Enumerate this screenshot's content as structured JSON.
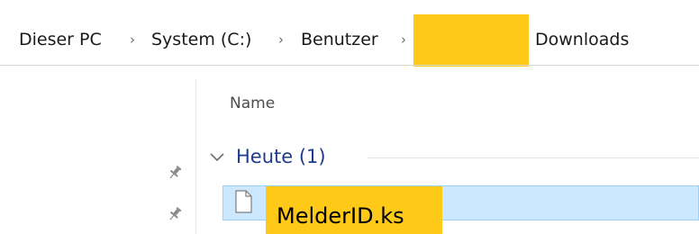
{
  "breadcrumb": {
    "items": [
      {
        "label": "Dieser PC"
      },
      {
        "label": "System (C:)"
      },
      {
        "label": "Benutzer"
      },
      {
        "label": ""
      },
      {
        "label": "Downloads"
      }
    ],
    "separator_icon": "chevron-right-icon"
  },
  "file_list": {
    "column_header": "Name",
    "groups": [
      {
        "label": "Heute (1)",
        "expanded": true,
        "files": [
          {
            "name": "MelderID.ks",
            "icon": "generic-file-icon",
            "selected": true
          }
        ]
      }
    ]
  },
  "nav_pane": {
    "pin_icons": [
      "pin-icon",
      "pin-icon"
    ]
  },
  "colors": {
    "selection_bg": "#cce8ff",
    "selection_border": "#99d1ff",
    "group_label": "#1f3b8c",
    "redaction": "#ffc917"
  }
}
